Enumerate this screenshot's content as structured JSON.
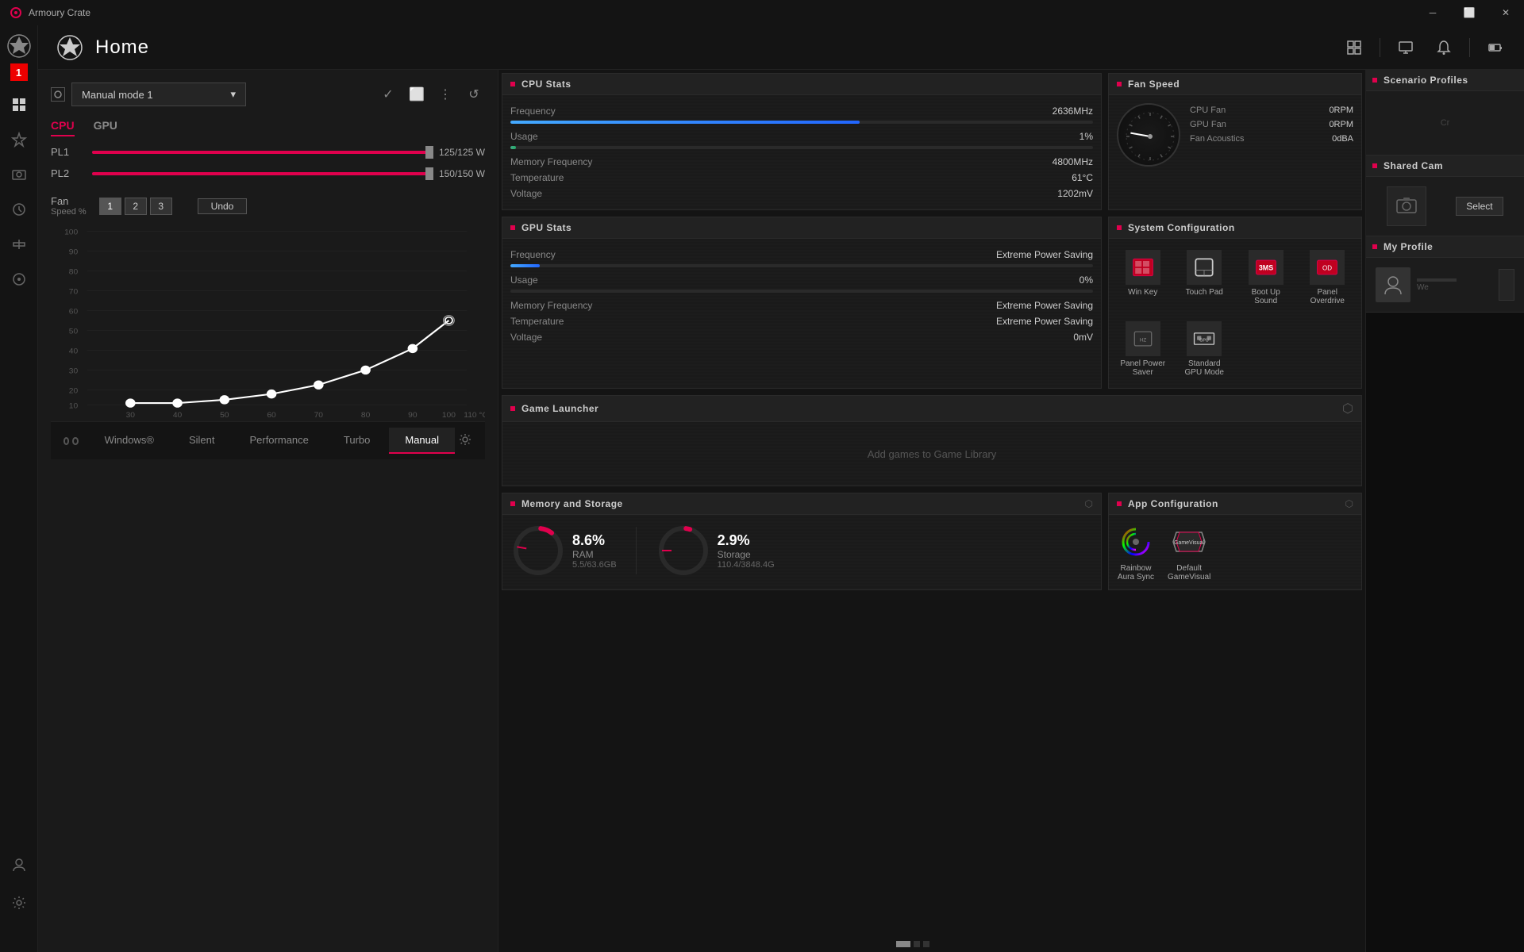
{
  "app": {
    "title": "Armoury Crate",
    "page_title": "Home"
  },
  "titlebar": {
    "title": "Armoury Crate",
    "minimize_label": "─",
    "restore_label": "⬜",
    "close_label": "✕"
  },
  "topbar": {
    "title": "Home"
  },
  "sidebar": {
    "number": "1",
    "items": [
      {
        "label": "home",
        "icon": "⊞"
      },
      {
        "label": "aura",
        "icon": "◈"
      },
      {
        "label": "devices",
        "icon": "⬡"
      },
      {
        "label": "settings",
        "icon": "⚙"
      },
      {
        "label": "update",
        "icon": "↺"
      },
      {
        "label": "tools",
        "icon": "⚒"
      },
      {
        "label": "game",
        "icon": "◉"
      },
      {
        "label": "user",
        "icon": "👤"
      },
      {
        "label": "config",
        "icon": "⚙"
      }
    ]
  },
  "left_panel": {
    "profile_selector": {
      "label": "Manual mode 1",
      "placeholder": "Manual mode 1"
    },
    "tabs": {
      "cpu": "CPU",
      "gpu": "GPU"
    },
    "pl1": {
      "label": "PL1",
      "value": "125/125 W"
    },
    "pl2": {
      "label": "PL2",
      "value": "150/150 W"
    },
    "fan": {
      "label": "Fan",
      "sublabel": "Speed %",
      "buttons": [
        "1",
        "2",
        "3"
      ],
      "active_btn": 0,
      "undo": "Undo"
    },
    "chart": {
      "x_axis": [
        "30",
        "40",
        "50",
        "60",
        "70",
        "80",
        "90",
        "100",
        "110 °C"
      ],
      "y_axis": [
        "10",
        "20",
        "30",
        "40",
        "50",
        "60",
        "70",
        "80",
        "90",
        "100"
      ]
    }
  },
  "cpu_stats": {
    "title": "CPU Stats",
    "frequency": {
      "label": "Frequency",
      "value": "2636MHz"
    },
    "usage": {
      "label": "Usage",
      "value": "1%"
    },
    "usage_pct": 1,
    "memory_frequency": {
      "label": "Memory Frequency",
      "value": "4800MHz"
    },
    "temperature": {
      "label": "Temperature",
      "value": "61°C"
    },
    "voltage": {
      "label": "Voltage",
      "value": "1202mV"
    }
  },
  "gpu_stats": {
    "title": "GPU Stats",
    "frequency": {
      "label": "Frequency",
      "value": "Extreme Power Saving"
    },
    "usage": {
      "label": "Usage",
      "value": "0%"
    },
    "usage_pct": 0,
    "memory_frequency": {
      "label": "Memory Frequency",
      "value": "Extreme Power Saving"
    },
    "temperature": {
      "label": "Temperature",
      "value": "Extreme Power Saving"
    },
    "voltage": {
      "label": "Voltage",
      "value": "0mV"
    }
  },
  "fan_speed": {
    "title": "Fan Speed",
    "cpu_fan": {
      "label": "CPU Fan",
      "value": "0RPM"
    },
    "gpu_fan": {
      "label": "GPU Fan",
      "value": "0RPM"
    },
    "fan_acoustics": {
      "label": "Fan Acoustics",
      "value": "0dBA"
    }
  },
  "system_config": {
    "title": "System Configuration",
    "items": [
      {
        "label": "Win Key",
        "icon": "win"
      },
      {
        "label": "Touch Pad",
        "icon": "touchpad"
      },
      {
        "label": "Boot Up Sound",
        "icon": "sound"
      },
      {
        "label": "Panel Overdrive",
        "icon": "panel"
      },
      {
        "label": "Panel Power Saver",
        "icon": "powersave"
      },
      {
        "label": "Standard GPU Mode",
        "icon": "gpu"
      }
    ]
  },
  "scenario_profiles": {
    "title": "Scenario Profiles"
  },
  "shared_cam": {
    "title": "Shared Cam",
    "select_label": "Select"
  },
  "my_profile": {
    "title": "My Profile",
    "we_label": "We"
  },
  "game_launcher": {
    "title": "Game Launcher",
    "empty_text": "Add games to Game Library"
  },
  "memory_storage": {
    "title": "Memory and Storage",
    "ram": {
      "percent": "8.6%",
      "label": "RAM",
      "detail": "5.5/63.6GB",
      "value": 8.6
    },
    "storage": {
      "percent": "2.9%",
      "label": "Storage",
      "detail": "110.4/3848.4G",
      "value": 2.9
    }
  },
  "app_config": {
    "title": "App Configuration",
    "items": [
      {
        "label": "Rainbow\nAura Sync",
        "icon": "rainbow"
      },
      {
        "label": "Default\nGameVisual",
        "icon": "gamevisual"
      }
    ]
  },
  "profile_tabs": [
    {
      "label": "Windows®",
      "active": false
    },
    {
      "label": "Silent",
      "active": false
    },
    {
      "label": "Performance",
      "active": false
    },
    {
      "label": "Turbo",
      "active": false
    },
    {
      "label": "Manual",
      "active": true
    }
  ]
}
